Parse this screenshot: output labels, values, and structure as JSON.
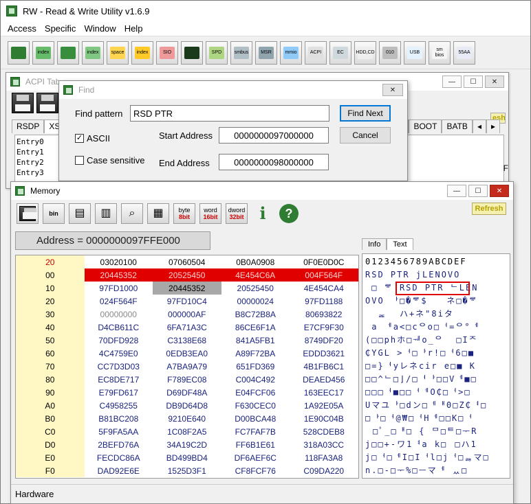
{
  "app": {
    "title": "RW - Read & Write Utility v1.6.9"
  },
  "menu": [
    "Access",
    "Specific",
    "Window",
    "Help"
  ],
  "toolbar": [
    {
      "icon": "pci-card-icon",
      "label": ""
    },
    {
      "icon": "index-icon",
      "label": "index"
    },
    {
      "icon": "memory-icon",
      "label": ""
    },
    {
      "icon": "index-icon",
      "label": "index"
    },
    {
      "icon": "io-space-icon",
      "label": "space"
    },
    {
      "icon": "io-index-icon",
      "label": "index"
    },
    {
      "icon": "sio-icon",
      "label": "SIO"
    },
    {
      "icon": "oscilloscope-icon",
      "label": ""
    },
    {
      "icon": "spd-icon",
      "label": "SPD"
    },
    {
      "icon": "smbus-icon",
      "label": "smbus"
    },
    {
      "icon": "msr-icon",
      "label": "MSR"
    },
    {
      "icon": "mmio-icon",
      "label": "mmio"
    },
    {
      "icon": "acpi-icon",
      "label": "ACPI"
    },
    {
      "icon": "ec-icon",
      "label": "EC"
    },
    {
      "icon": "hdd-icon",
      "label": "HDD,CD"
    },
    {
      "icon": "cmos-icon",
      "label": "010"
    },
    {
      "icon": "usb-icon",
      "label": "USB"
    },
    {
      "icon": "smbios-icon",
      "label": "sm bios"
    },
    {
      "icon": "uefi-icon",
      "label": "55AA"
    }
  ],
  "acpi": {
    "title": "ACPI Tab",
    "tabs": [
      "RSDP",
      "XSD"
    ],
    "tabs_right": [
      "2",
      "BOOT",
      "BATB"
    ],
    "entries": [
      "Entry0",
      "Entry1",
      "Entry2",
      "Entry3"
    ],
    "refresh": "esh",
    "side_letter": "F"
  },
  "find": {
    "title": "Find",
    "pattern_label": "Find pattern",
    "pattern_value": "RSD PTR",
    "ascii_label": "ASCII",
    "ascii_checked": true,
    "case_label": "Case sensitive",
    "case_checked": false,
    "start_label": "Start Address",
    "start_value": "0000000097000000",
    "end_label": "End Address",
    "end_value": "0000000098000000",
    "find_next": "Find Next",
    "cancel": "Cancel"
  },
  "memory": {
    "title": "Memory",
    "tool_labels": {
      "byte": "byte",
      "byte_bits": "8bit",
      "word": "word",
      "word_bits": "16bit",
      "dword": "dword",
      "dword_bits": "32bit"
    },
    "refresh": "Refresh",
    "address": "Address = 0000000097FFE000",
    "tabs": [
      "Info",
      "Text"
    ],
    "header": [
      "20",
      "03020100",
      "07060504",
      "0B0A0908",
      "0F0E0D0C"
    ],
    "rows": [
      [
        "00",
        "20445352",
        "20525450",
        "4E454C6A",
        "004F564F"
      ],
      [
        "10",
        "97FD1000",
        "20445352",
        "20525450",
        "4E454CA4"
      ],
      [
        "20",
        "024F564F",
        "97FD10C4",
        "00000024",
        "97FD1188"
      ],
      [
        "30",
        "00000000",
        "000000AF",
        "B8C72B8A",
        "80693822"
      ],
      [
        "40",
        "D4CB611C",
        "6FA71A3C",
        "86CE6F1A",
        "E7CF9F30"
      ],
      [
        "50",
        "70DFD928",
        "C3138E68",
        "841A5FB1",
        "8749DF20"
      ],
      [
        "60",
        "4C4759E0",
        "0EDB3EA0",
        "A89F72BA",
        "EDDD3621"
      ],
      [
        "70",
        "CC7D3D03",
        "A7BA9A79",
        "651FD369",
        "4B1FB6C1"
      ],
      [
        "80",
        "EC8DE717",
        "F789EC08",
        "C004C492",
        "DEAED456"
      ],
      [
        "90",
        "E79FD617",
        "D69DF48A",
        "E04FCF06",
        "163EEC17"
      ],
      [
        "A0",
        "C4958255",
        "DB9D64D8",
        "F630CEC0",
        "1A92E05A"
      ],
      [
        "B0",
        "B81BC208",
        "9210E640",
        "D00BCA48",
        "1E90C04B"
      ],
      [
        "C0",
        "5F9FA5AA",
        "1C08F2A5",
        "FC7FAF7B",
        "528CDEB8"
      ],
      [
        "D0",
        "2BEFD76A",
        "34A19C2D",
        "FF6B1E61",
        "318A03CC"
      ],
      [
        "E0",
        "FECDC86A",
        "BD499BD4",
        "DF6AEF6C",
        "118FA3A8"
      ],
      [
        "F0",
        "DAD92E6E",
        "1525D3F1",
        "CF8FCF76",
        "C09DA220"
      ]
    ],
    "text_header": "0123456789ABCDEF",
    "text_rows": [
      "RSD PTR jLENOVO",
      " □ ᄛ RSD PTR ᄂLEN",
      "OVO ᅡ□�ᄛ$   ネ□�ᄛ",
      "  ᆴ  ハ+ネ\"8iタ",
      " a ᅦa<□cᄋo□ᅥ=ᄋ°ᅦ",
      "(□□phホ□ᅰo_ᄋ  □Iᄌ",
      "₵YGL >ᅥ□ᅡr!□ᅥ6□■",
      "□=}ᅥyレネcir e□■ K",
      "□□^ᄂ□⌋/□ᅥᅡ□□Vᅦ■□",
      "□□□ᅥ■□□ᅥᅦO₵□ᅥ>□",
      "Uマユᅡ□dン□ᅦᅢ0□Z₵ᅧ□",
      "□ᅡ□ᅥ@₩□ᅥHᅦ□□K□ᅥ",
      "ᅠ□ﾟ_□ᅢ□ { ᄆ□ᄐ□ᅮR",
      "j□□+-ワ1ᅧa k□ᅠ□ハ1",
      "j□ᅥ□ᅦI□Iᅥl□jᅥ□ᆶマ□",
      "n.□-□ᅮ%□ᅳマᅦ ᆻ□"
    ],
    "status": "Hardware"
  }
}
